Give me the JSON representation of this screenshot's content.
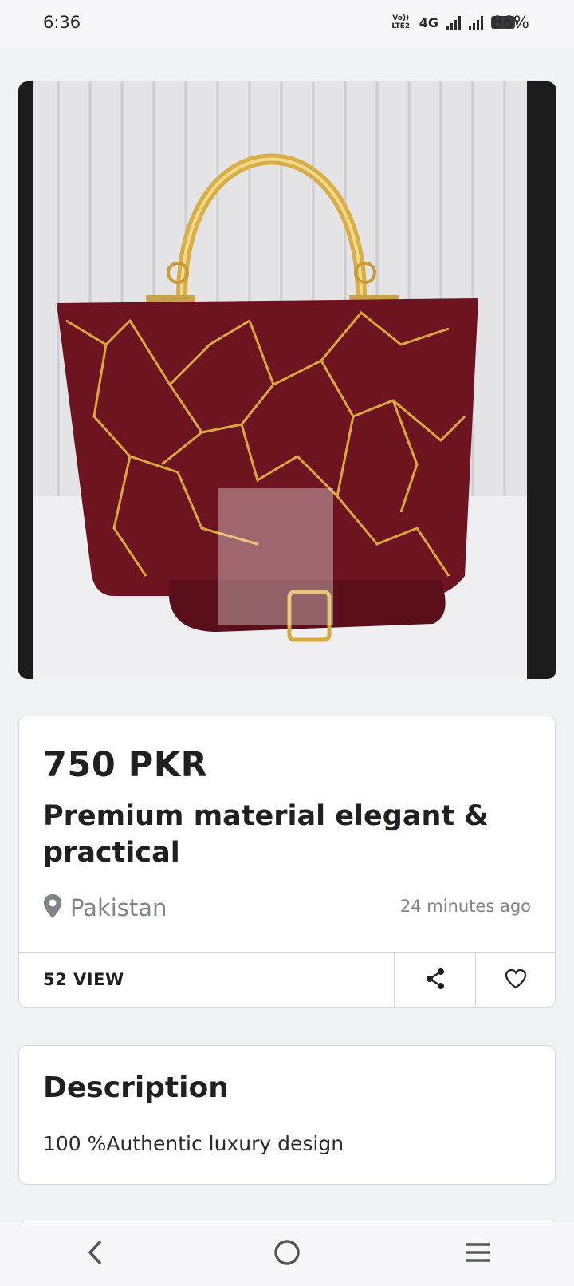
{
  "status_bar": {
    "time": "6:36",
    "volte": "Vo)) LTE2",
    "network": "4G",
    "battery": "86%"
  },
  "product": {
    "image_icon": "handbag-photo",
    "price": "750 PKR",
    "title": "Premium material elegant & practical",
    "location": "Pakistan",
    "posted": "24 minutes ago",
    "views": "52 VIEW"
  },
  "description": {
    "heading": "Description",
    "text": "100 %Authentic luxury design"
  },
  "icons": {
    "location": "map-pin-icon",
    "share": "share-icon",
    "favorite": "heart-icon",
    "back": "back-icon",
    "home": "home-icon",
    "menu": "menu-icon"
  },
  "colors": {
    "background": "#f1f2f6",
    "text": "#1f1f24",
    "muted": "#808287",
    "bag": "#6e1420",
    "gold": "#d8a93a"
  }
}
